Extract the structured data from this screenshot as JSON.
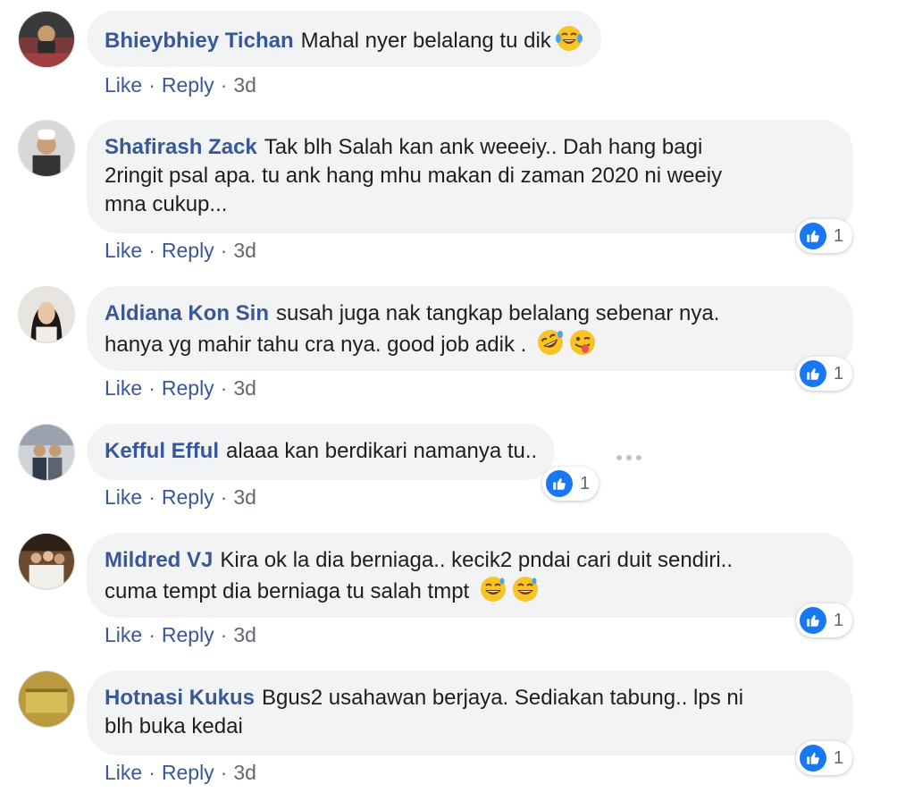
{
  "comments": [
    {
      "author": "Bhieybhiey Tichan",
      "text_lines": [
        "Mahal nyer belalang tu dik"
      ],
      "emojis": [
        "tears-of-joy"
      ],
      "like": "Like",
      "reply": "Reply",
      "time": "3d",
      "reactions": ""
    },
    {
      "author": "Shafirash Zack",
      "text_lines": [
        "Tak blh Salah kan ank weeeiy.. Dah hang bagi",
        "2ringit psal apa. tu ank hang mhu makan di zaman 2020 ni weeiy",
        "mna cukup..."
      ],
      "emojis": [],
      "like": "Like",
      "reply": "Reply",
      "time": "3d",
      "reactions": "1"
    },
    {
      "author": "Aldiana Kon Sin",
      "text_lines": [
        "susah juga nak tangkap belalang sebenar nya.",
        "hanya yg mahir tahu cra nya. good job adik ."
      ],
      "emojis": [
        "rolling-laughing",
        "winking-tongue"
      ],
      "like": "Like",
      "reply": "Reply",
      "time": "3d",
      "reactions": "1"
    },
    {
      "author": "Kefful Efful",
      "text_lines": [
        "alaaa kan berdikari namanya tu.."
      ],
      "emojis": [],
      "like": "Like",
      "reply": "Reply",
      "time": "3d",
      "reactions": "1"
    },
    {
      "author": "Mildred VJ",
      "text_lines": [
        "Kira ok la dia berniaga.. kecik2 pndai cari duit sendiri..",
        "cuma tempt dia berniaga tu salah tmpt"
      ],
      "emojis": [
        "grinning-sweat",
        "grinning-sweat"
      ],
      "like": "Like",
      "reply": "Reply",
      "time": "3d",
      "reactions": "1"
    },
    {
      "author": "Hotnasi Kukus",
      "text_lines": [
        "Bgus2 usahawan berjaya. Sediakan tabung.. lps ni",
        "blh buka kedai"
      ],
      "emojis": [],
      "like": "Like",
      "reply": "Reply",
      "time": "3d",
      "reactions": "1"
    }
  ],
  "icons": {
    "reaction": "like-icon",
    "more": "more-options-icon"
  },
  "colors": {
    "author": "#385898",
    "bubble": "#f2f3f5",
    "like_blue": "#1877f2",
    "meta": "#616770"
  }
}
